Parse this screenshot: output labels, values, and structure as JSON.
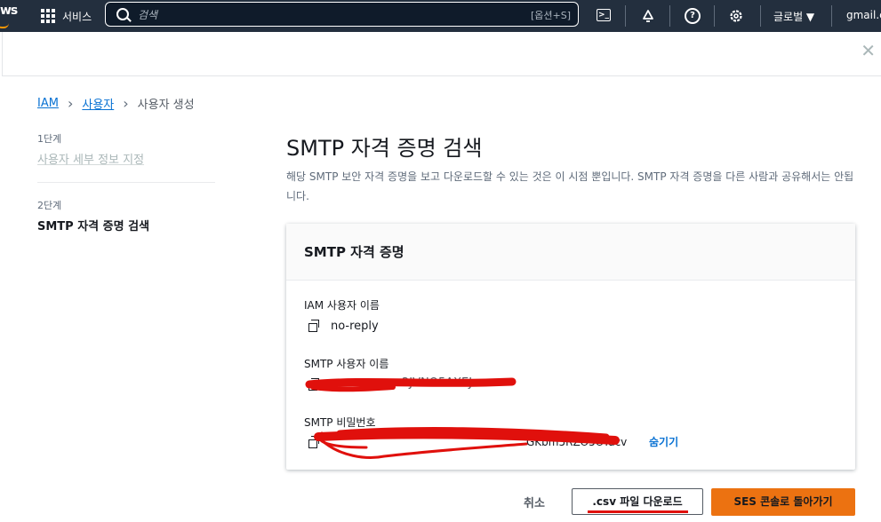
{
  "topbar": {
    "logo": "ws",
    "services_label": "서비스",
    "search_placeholder": "검색",
    "search_shortcut": "[옵션+S]",
    "region_label": "글로벌 ▼",
    "account_label": "gmail.c"
  },
  "breadcrumb": {
    "items": [
      "IAM",
      "사용자"
    ],
    "current": "사용자 생성"
  },
  "steps": [
    {
      "num": "1단계",
      "label": "사용자 세부 정보 지정"
    },
    {
      "num": "2단계",
      "label": "SMTP 자격 증명 검색"
    }
  ],
  "main": {
    "title": "SMTP 자격 증명 검색",
    "description": "해당 SMTP 보안 자격 증명을 보고 다운로드할 수 있는 것은 이 시점 뿐입니다. SMTP 자격 증명을 다른 사람과 공유해서는 안됩니다."
  },
  "panel": {
    "title": "SMTP 자격 증명",
    "fields": [
      {
        "label": "IAM 사용자 이름",
        "value": "no-reply"
      },
      {
        "label": "SMTP 사용자 이름",
        "value": "2JVNO5AXEJ"
      },
      {
        "label": "SMTP 비밀번호",
        "value": "GKbm5RZO5OYacv"
      }
    ],
    "hide_label": "숨기기"
  },
  "footer": {
    "cancel_label": "취소",
    "csv_label": ".csv 파일 다운로드",
    "ses_label": "SES 콘솔로 돌아가기"
  },
  "colors": {
    "nav_bg": "#232f3e",
    "link": "#0972d3",
    "primary_button": "#ec7211",
    "redaction": "#e0100c"
  }
}
